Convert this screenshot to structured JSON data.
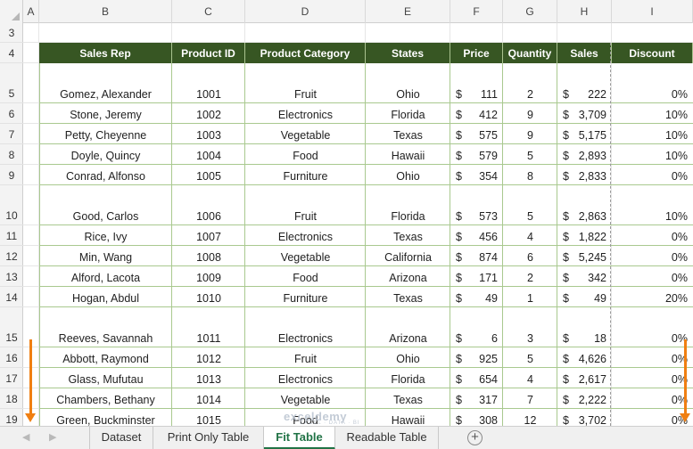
{
  "columns": [
    "A",
    "B",
    "C",
    "D",
    "E",
    "F",
    "G",
    "H",
    "I"
  ],
  "rows": [
    "3",
    "4",
    "5",
    "6",
    "7",
    "8",
    "9",
    "10",
    "11",
    "12",
    "13",
    "14",
    "15",
    "16",
    "17",
    "18",
    "19"
  ],
  "table_headers": [
    "Sales Rep",
    "Product ID",
    "Product Category",
    "States",
    "Price",
    "Quantity",
    "Sales",
    "Discount"
  ],
  "data_rows": [
    {
      "rep": "Gomez, Alexander",
      "id": "1001",
      "cat": "Fruit",
      "state": "Ohio",
      "price": "111",
      "qty": "2",
      "sales": "222",
      "disc": "0%"
    },
    {
      "rep": "Stone, Jeremy",
      "id": "1002",
      "cat": "Electronics",
      "state": "Florida",
      "price": "412",
      "qty": "9",
      "sales": "3,709",
      "disc": "10%"
    },
    {
      "rep": "Petty, Cheyenne",
      "id": "1003",
      "cat": "Vegetable",
      "state": "Texas",
      "price": "575",
      "qty": "9",
      "sales": "5,175",
      "disc": "10%"
    },
    {
      "rep": "Doyle, Quincy",
      "id": "1004",
      "cat": "Food",
      "state": "Hawaii",
      "price": "579",
      "qty": "5",
      "sales": "2,893",
      "disc": "10%"
    },
    {
      "rep": "Conrad, Alfonso",
      "id": "1005",
      "cat": "Furniture",
      "state": "Ohio",
      "price": "354",
      "qty": "8",
      "sales": "2,833",
      "disc": "0%"
    },
    {
      "rep": "Good, Carlos",
      "id": "1006",
      "cat": "Fruit",
      "state": "Florida",
      "price": "573",
      "qty": "5",
      "sales": "2,863",
      "disc": "10%"
    },
    {
      "rep": "Rice, Ivy",
      "id": "1007",
      "cat": "Electronics",
      "state": "Texas",
      "price": "456",
      "qty": "4",
      "sales": "1,822",
      "disc": "0%"
    },
    {
      "rep": "Min, Wang",
      "id": "1008",
      "cat": "Vegetable",
      "state": "California",
      "price": "874",
      "qty": "6",
      "sales": "5,245",
      "disc": "0%"
    },
    {
      "rep": "Alford, Lacota",
      "id": "1009",
      "cat": "Food",
      "state": "Arizona",
      "price": "171",
      "qty": "2",
      "sales": "342",
      "disc": "0%"
    },
    {
      "rep": "Hogan, Abdul",
      "id": "1010",
      "cat": "Furniture",
      "state": "Texas",
      "price": "49",
      "qty": "1",
      "sales": "49",
      "disc": "20%"
    },
    {
      "rep": "Reeves, Savannah",
      "id": "1011",
      "cat": "Electronics",
      "state": "Arizona",
      "price": "6",
      "qty": "3",
      "sales": "18",
      "disc": "0%"
    },
    {
      "rep": "Abbott, Raymond",
      "id": "1012",
      "cat": "Fruit",
      "state": "Ohio",
      "price": "925",
      "qty": "5",
      "sales": "4,626",
      "disc": "0%"
    },
    {
      "rep": "Glass, Mufutau",
      "id": "1013",
      "cat": "Electronics",
      "state": "Florida",
      "price": "654",
      "qty": "4",
      "sales": "2,617",
      "disc": "0%"
    },
    {
      "rep": "Chambers, Bethany",
      "id": "1014",
      "cat": "Vegetable",
      "state": "Texas",
      "price": "317",
      "qty": "7",
      "sales": "2,222",
      "disc": "0%"
    },
    {
      "rep": "Green, Buckminster",
      "id": "1015",
      "cat": "Food",
      "state": "Hawaii",
      "price": "308",
      "qty": "12",
      "sales": "3,702",
      "disc": "0%"
    }
  ],
  "currency_symbol": "$",
  "sheet_tabs": [
    "Dataset",
    "Print Only Table",
    "Fit Table",
    "Readable Table"
  ],
  "active_tab": "Fit Table",
  "watermark": {
    "brand": "exceldemy",
    "tagline": "EXCEL · DATA · BI"
  },
  "colors": {
    "header_fill": "#375623",
    "active_tab": "#217346",
    "arrow": "#f07f12"
  }
}
